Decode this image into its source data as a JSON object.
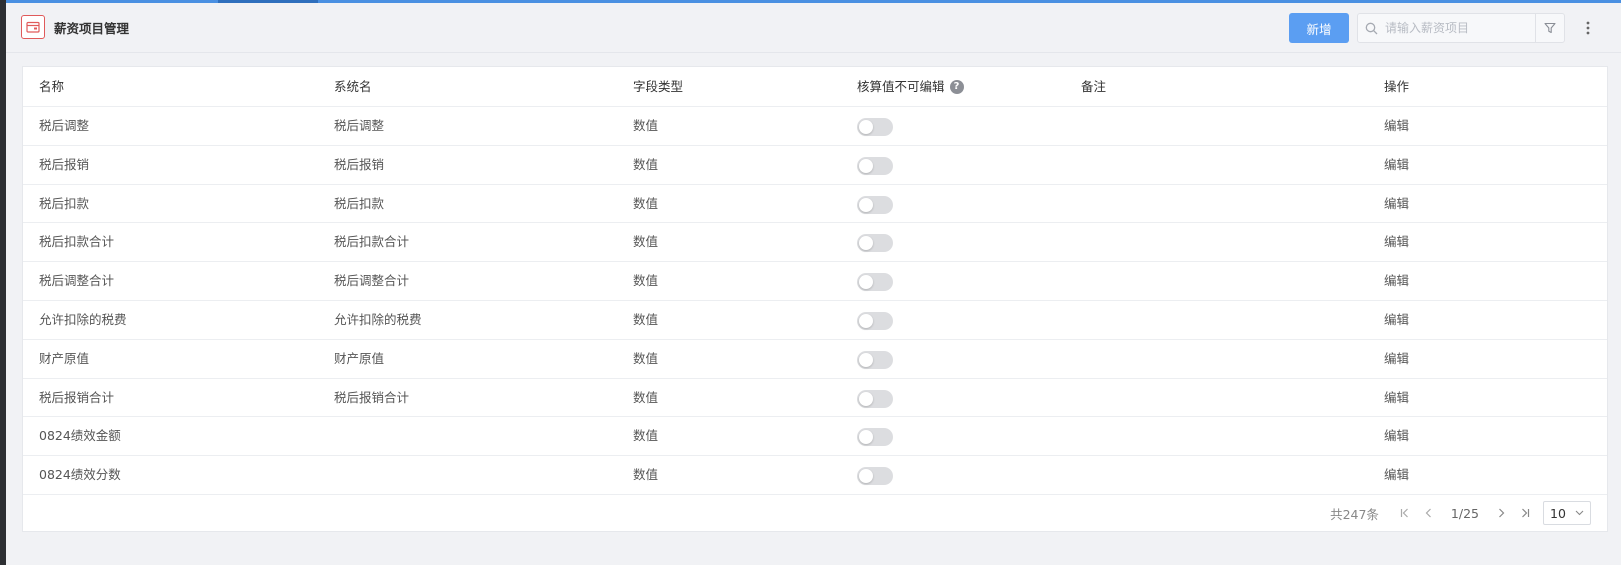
{
  "header": {
    "title": "薪资项目管理",
    "add_label": "新增",
    "search_placeholder": "请输入薪资项目",
    "icons": [
      "calendar-icon",
      "search-icon",
      "filter-icon",
      "more-vertical-icon"
    ]
  },
  "table": {
    "columns": [
      "名称",
      "系统名",
      "字段类型",
      "核算值不可编辑",
      "备注",
      "操作"
    ],
    "help_icon": "?",
    "rows": [
      {
        "name": "税后调整",
        "sys": "税后调整",
        "type": "数值",
        "locked": false,
        "remark": "",
        "action": "编辑"
      },
      {
        "name": "税后报销",
        "sys": "税后报销",
        "type": "数值",
        "locked": false,
        "remark": "",
        "action": "编辑"
      },
      {
        "name": "税后扣款",
        "sys": "税后扣款",
        "type": "数值",
        "locked": false,
        "remark": "",
        "action": "编辑"
      },
      {
        "name": "税后扣款合计",
        "sys": "税后扣款合计",
        "type": "数值",
        "locked": false,
        "remark": "",
        "action": "编辑"
      },
      {
        "name": "税后调整合计",
        "sys": "税后调整合计",
        "type": "数值",
        "locked": false,
        "remark": "",
        "action": "编辑"
      },
      {
        "name": "允许扣除的税费",
        "sys": "允许扣除的税费",
        "type": "数值",
        "locked": false,
        "remark": "",
        "action": "编辑"
      },
      {
        "name": "财产原值",
        "sys": "财产原值",
        "type": "数值",
        "locked": false,
        "remark": "",
        "action": "编辑"
      },
      {
        "name": "税后报销合计",
        "sys": "税后报销合计",
        "type": "数值",
        "locked": false,
        "remark": "",
        "action": "编辑"
      },
      {
        "name": "0824绩效金额",
        "sys": "",
        "type": "数值",
        "locked": false,
        "remark": "",
        "action": "编辑"
      },
      {
        "name": "0824绩效分数",
        "sys": "",
        "type": "数值",
        "locked": false,
        "remark": "",
        "action": "编辑"
      }
    ]
  },
  "pagination": {
    "total": "共247条",
    "page": "1/25",
    "page_size": "10"
  },
  "colors": {
    "accent": "#5b9ef2",
    "link": "#4a8ee6",
    "logo_border": "#e05a5a"
  }
}
